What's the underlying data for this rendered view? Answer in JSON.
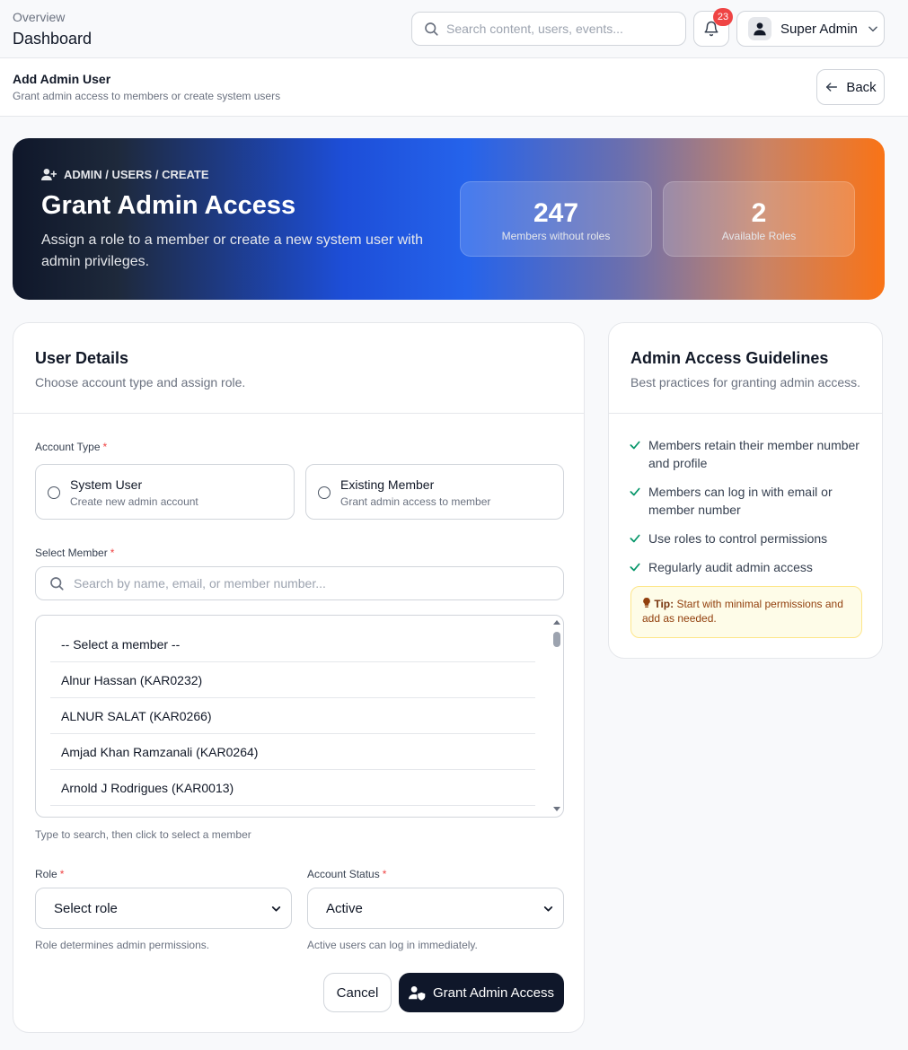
{
  "header": {
    "breadcrumb": "Overview",
    "title": "Dashboard",
    "search_placeholder": "Search content, users, events...",
    "notification_count": "23",
    "user_name": "Super Admin"
  },
  "subheader": {
    "title": "Add Admin User",
    "description": "Grant admin access to members or create system users",
    "back_label": "Back"
  },
  "hero": {
    "breadcrumb": "ADMIN / USERS / CREATE",
    "title": "Grant Admin Access",
    "description": "Assign a role to a member or create a new system user with admin privileges.",
    "stats": [
      {
        "value": "247",
        "label": "Members without roles"
      },
      {
        "value": "2",
        "label": "Available Roles"
      }
    ]
  },
  "form": {
    "title": "User Details",
    "subtitle": "Choose account type and assign role.",
    "account_type_label": "Account Type",
    "required_mark": "*",
    "account_types": [
      {
        "title": "System User",
        "description": "Create new admin account"
      },
      {
        "title": "Existing Member",
        "description": "Grant admin access to member"
      }
    ],
    "select_member_label": "Select Member",
    "member_search_placeholder": "Search by name, email, or member number...",
    "members": [
      "-- Select a member --",
      "Alnur Hassan (KAR0232)",
      "ALNUR SALAT (KAR0266)",
      "Amjad Khan Ramzanali (KAR0264)",
      "Arnold J Rodrigues (KAR0013)"
    ],
    "member_hint": "Type to search, then click to select a member",
    "role_label": "Role",
    "role_value": "Select role",
    "role_hint": "Role determines admin permissions.",
    "status_label": "Account Status",
    "status_value": "Active",
    "status_hint": "Active users can log in immediately.",
    "cancel_label": "Cancel",
    "submit_label": "Grant Admin Access"
  },
  "guidelines": {
    "title": "Admin Access Guidelines",
    "subtitle": "Best practices for granting admin access.",
    "items": [
      "Members retain their member number and profile",
      "Members can log in with email or member number",
      "Use roles to control permissions",
      "Regularly audit admin access"
    ],
    "tip_label": "Tip:",
    "tip_text": "Start with minimal permissions and add as needed."
  },
  "colors": {
    "accent_dark": "#0f172a",
    "hero_blue": "#2563eb",
    "hero_orange": "#f97316",
    "check_green": "#059669",
    "badge_red": "#ef4444"
  }
}
